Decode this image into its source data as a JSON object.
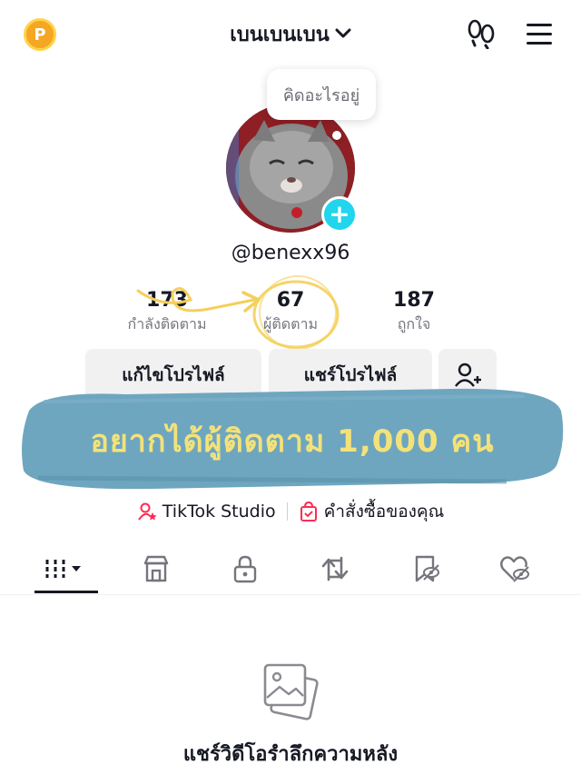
{
  "header": {
    "coin_label": "P",
    "username": "เบนเบนเบน",
    "dropdown_glyph": "⌄"
  },
  "bubble": {
    "text": "คิดอะไรอยู่"
  },
  "profile": {
    "handle": "@benexx96"
  },
  "stats": [
    {
      "value": "173",
      "label": "กำลังติดตาม"
    },
    {
      "value": "67",
      "label": "ผู้ติดตาม"
    },
    {
      "value": "187",
      "label": "ถูกใจ"
    }
  ],
  "buttons": {
    "edit_profile": "แก้ไขโปรไฟล์",
    "share_profile": "แชร์โปรไฟล์"
  },
  "banner": {
    "text": "อยากได้ผู้ติดตาม 1,000 คน"
  },
  "links": {
    "studio": "TikTok Studio",
    "orders": "คำสั่งซื้อของคุณ"
  },
  "tabs": [
    {
      "icon": "grid-icon"
    },
    {
      "icon": "shop-icon"
    },
    {
      "icon": "lock-icon"
    },
    {
      "icon": "repost-icon"
    },
    {
      "icon": "saved-icon"
    },
    {
      "icon": "liked-icon"
    }
  ],
  "empty_state": {
    "text": "แชร์วิดีโอรำลึกความหลัง"
  },
  "colors": {
    "accent_cyan": "#20d5ec",
    "studio_pink": "#fe2c55",
    "banner_blue": "#6ea6bf",
    "banner_text": "#f3e27a",
    "annotation": "#f5cf5a"
  }
}
